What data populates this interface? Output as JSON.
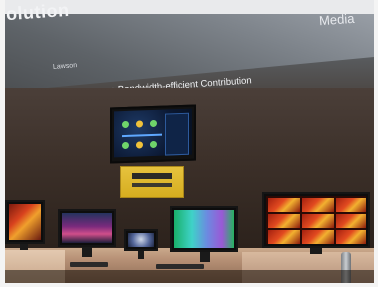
{
  "banner": {
    "title_fragment": "olution",
    "media_label": "Media",
    "tag": "Lawson",
    "subtitle": "Low Latency, Bandwidth-efficient Contribution"
  },
  "colors": {
    "banner": "#7d838a",
    "wall": "#3b2f28",
    "yellow_box": "#e6c23e",
    "counter": "#b89277"
  }
}
